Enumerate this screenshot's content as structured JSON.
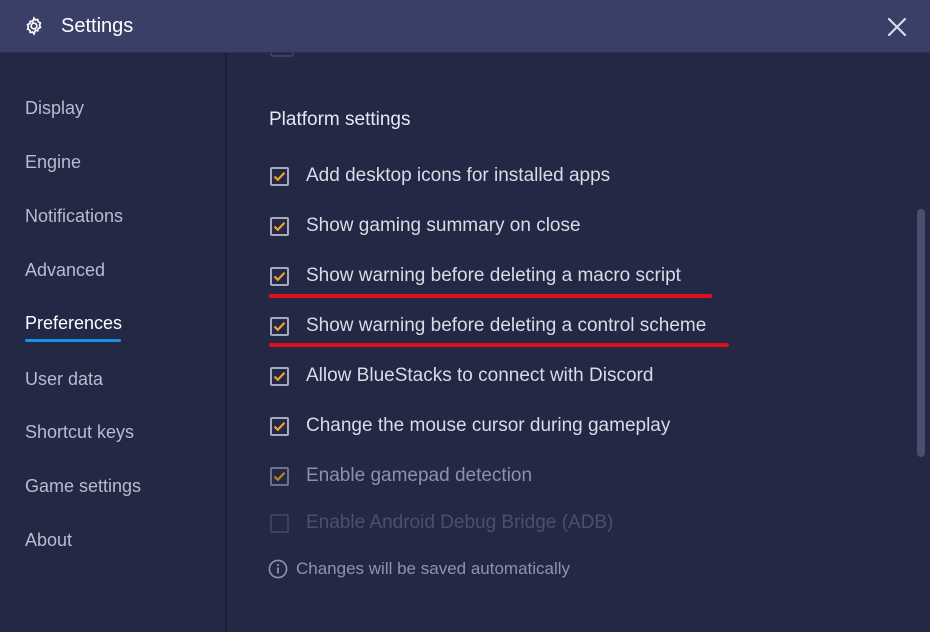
{
  "window": {
    "title": "Settings",
    "icon": "gear-icon",
    "close_icon": "close-icon"
  },
  "sidebar": {
    "items": [
      {
        "label": "Display"
      },
      {
        "label": "Engine"
      },
      {
        "label": "Notifications"
      },
      {
        "label": "Advanced"
      },
      {
        "label": "Preferences",
        "active": true
      },
      {
        "label": "User data"
      },
      {
        "label": "Shortcut keys"
      },
      {
        "label": "Game settings"
      },
      {
        "label": "About"
      }
    ]
  },
  "main": {
    "section_title": "Platform settings",
    "options": [
      {
        "label": "Add desktop icons for installed apps",
        "checked": true
      },
      {
        "label": "Show gaming summary on close",
        "checked": true
      },
      {
        "label": "Show warning before deleting a macro script",
        "checked": true,
        "highlighted": true
      },
      {
        "label": "Show warning before deleting a control scheme",
        "checked": true,
        "highlighted": true
      },
      {
        "label": "Allow BlueStacks to connect with Discord",
        "checked": true
      },
      {
        "label": "Change the mouse cursor during gameplay",
        "checked": true
      },
      {
        "label": "Enable gamepad detection",
        "checked": true,
        "dimmed": true
      },
      {
        "label": "Enable Android Debug Bridge (ADB)",
        "checked": false,
        "faded": true
      }
    ],
    "footer_note": "Changes will be saved automatically",
    "footer_icon": "info-icon"
  },
  "colors": {
    "accent_check": "#f0a226",
    "active_underline": "#1e8fe6",
    "highlight_line": "#e0101a",
    "titlebar": "#3a3f68",
    "background": "#232845"
  }
}
